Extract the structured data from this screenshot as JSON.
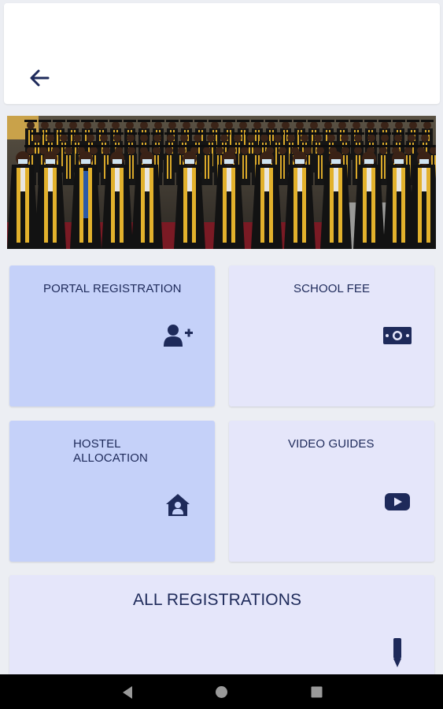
{
  "header": {
    "back_icon": "arrow-left-icon"
  },
  "banner": {
    "image": "graduation-ceremony-photo"
  },
  "tiles": [
    {
      "label": "PORTAL REGISTRATION",
      "icon": "add-user-icon"
    },
    {
      "label": "SCHOOL FEE",
      "icon": "banknote-icon"
    },
    {
      "label_line1": "HOSTEL",
      "label_line2": "ALLOCATION",
      "icon": "house-user-icon"
    },
    {
      "label": "VIDEO GUIDES",
      "icon": "youtube-icon"
    },
    {
      "label": "ALL REGISTRATIONS",
      "icon": "pen-icon"
    }
  ],
  "navbar": {
    "back": "triangle-back-icon",
    "home": "circle-home-icon",
    "recents": "square-recents-icon"
  },
  "colors": {
    "accent_dark": "#1e2a5a",
    "tile_blue": "#c5d1f9",
    "tile_light": "#e5e6fa",
    "background": "#eceef3"
  }
}
